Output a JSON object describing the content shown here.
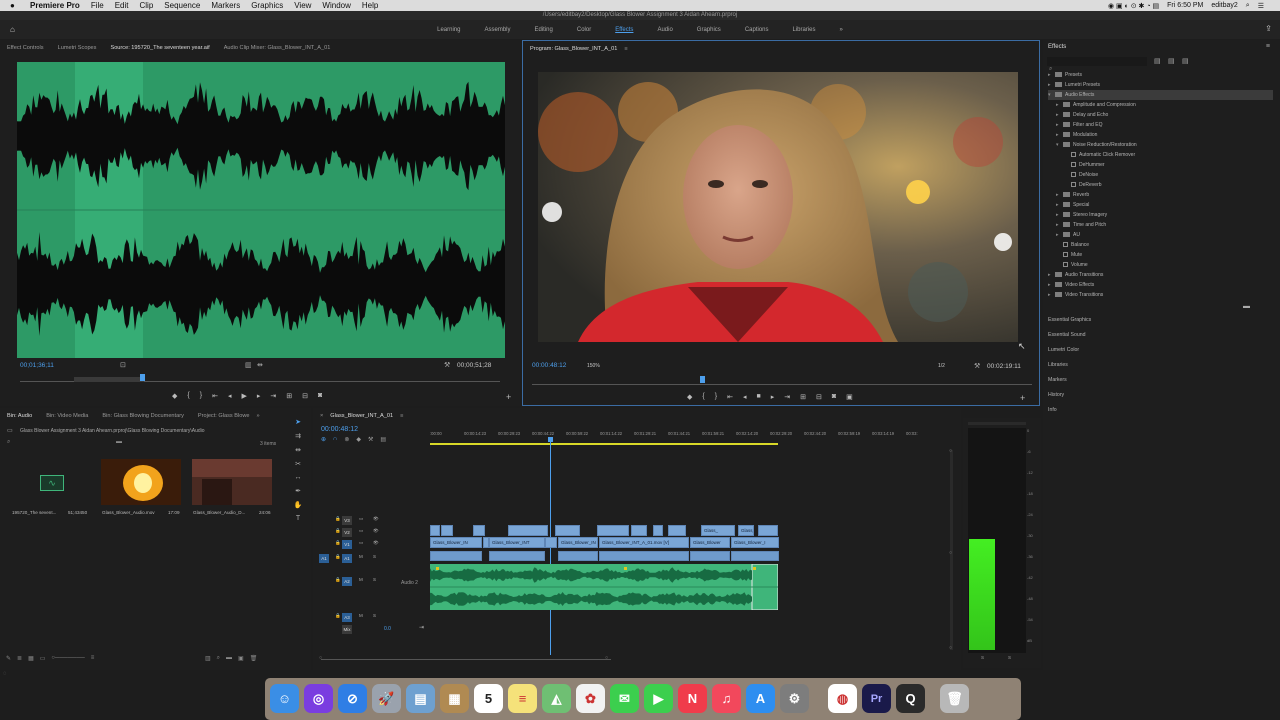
{
  "menubar": {
    "apple": "",
    "app_name": "Premiere Pro",
    "items": [
      "File",
      "Edit",
      "Clip",
      "Sequence",
      "Markers",
      "Graphics",
      "View",
      "Window",
      "Help"
    ],
    "clock": "Fri 6:50 PM",
    "user": "editbay2"
  },
  "titlebar": {
    "path": "/Users/editbay2/Desktop/Glass Blower Assignment 3 Aidan Ahearn.prproj"
  },
  "workspaces": [
    "Learning",
    "Assembly",
    "Editing",
    "Color",
    "Effects",
    "Audio",
    "Graphics",
    "Captions",
    "Libraries"
  ],
  "active_workspace": "Effects",
  "source_panel": {
    "tabs": [
      "Effect Controls",
      "Lumetri Scopes",
      "Source: 195720_The seventeen year.aif",
      "Audio Clip Mixer: Glass_Blower_INT_A_01"
    ],
    "timecode": "00;01;36;11",
    "duration": "00;00;51;28"
  },
  "program_panel": {
    "tab": "Program: Glass_Blower_INT_A_01",
    "timecode": "00:00:48:12",
    "zoom": "150%",
    "resolution": "1/2",
    "duration": "00:02:19:11"
  },
  "effects_panel": {
    "title": "Effects",
    "tree": [
      {
        "label": "Presets",
        "level": 0,
        "kind": "folder",
        "arrow": "▸"
      },
      {
        "label": "Lumetri Presets",
        "level": 0,
        "kind": "folder",
        "arrow": "▸"
      },
      {
        "label": "Audio Effects",
        "level": 0,
        "kind": "folder",
        "arrow": "▾",
        "selected": true
      },
      {
        "label": "Amplitude and Compression",
        "level": 1,
        "kind": "folder",
        "arrow": "▸"
      },
      {
        "label": "Delay and Echo",
        "level": 1,
        "kind": "folder",
        "arrow": "▸"
      },
      {
        "label": "Filter and EQ",
        "level": 1,
        "kind": "folder",
        "arrow": "▸"
      },
      {
        "label": "Modulation",
        "level": 1,
        "kind": "folder",
        "arrow": "▸"
      },
      {
        "label": "Noise Reduction/Restoration",
        "level": 1,
        "kind": "folder",
        "arrow": "▾"
      },
      {
        "label": "Automatic Click Remover",
        "level": 2,
        "kind": "fx",
        "arrow": ""
      },
      {
        "label": "DeHummer",
        "level": 2,
        "kind": "fx",
        "arrow": ""
      },
      {
        "label": "DeNoise",
        "level": 2,
        "kind": "fx",
        "arrow": ""
      },
      {
        "label": "DeReverb",
        "level": 2,
        "kind": "fx",
        "arrow": ""
      },
      {
        "label": "Reverb",
        "level": 1,
        "kind": "folder",
        "arrow": "▸"
      },
      {
        "label": "Special",
        "level": 1,
        "kind": "folder",
        "arrow": "▸"
      },
      {
        "label": "Stereo Imagery",
        "level": 1,
        "kind": "folder",
        "arrow": "▸"
      },
      {
        "label": "Time and Pitch",
        "level": 1,
        "kind": "folder",
        "arrow": "▸"
      },
      {
        "label": "AU",
        "level": 1,
        "kind": "folder",
        "arrow": "▸"
      },
      {
        "label": "Balance",
        "level": 1,
        "kind": "fx",
        "arrow": ""
      },
      {
        "label": "Mute",
        "level": 1,
        "kind": "fx",
        "arrow": ""
      },
      {
        "label": "Volume",
        "level": 1,
        "kind": "fx",
        "arrow": ""
      },
      {
        "label": "Audio Transitions",
        "level": 0,
        "kind": "folder",
        "arrow": "▸"
      },
      {
        "label": "Video Effects",
        "level": 0,
        "kind": "folder",
        "arrow": "▸"
      },
      {
        "label": "Video Transitions",
        "level": 0,
        "kind": "folder",
        "arrow": "▸"
      }
    ],
    "collapsed_panels": [
      "Essential Graphics",
      "Essential Sound",
      "Lumetri Color",
      "Libraries",
      "Markers",
      "History",
      "Info"
    ]
  },
  "project_panel": {
    "tabs": [
      "Bin: Audio",
      "Bin: Video Media",
      "Bin: Glass Blowing Documentary",
      "Project: Glass Blowe"
    ],
    "path": "Glass Blower Assignment 3 Aidan Ahearn.prproj\\Glass Blowing Documentary\\Audio",
    "count": "3 items",
    "items": [
      {
        "name": "195720_The sevent...",
        "duration": "51;43450"
      },
      {
        "name": "Glass_Blower_Audio.mov",
        "duration": "17:09"
      },
      {
        "name": "Glass_Blower_Audio_D...",
        "duration": "24:06"
      }
    ]
  },
  "timeline_panel": {
    "tab": "Glass_Blower_INT_A_01",
    "timecode": "00:00:48:12",
    "ruler": [
      ":00:00",
      "00:00:14:23",
      "00:00:29:23",
      "00:00:44:22",
      "00:00:59:22",
      "00:01:14:22",
      "00:01:29:21",
      "00:01:44:21",
      "00:01:59:21",
      "00:02:14:20",
      "00:02:29:20",
      "00:02:44:20",
      "00:02:59:19",
      "00:03:14:19",
      "00:03:"
    ],
    "tracks": [
      "V3",
      "V2",
      "V1",
      "A1",
      "A2",
      "A3",
      "Mix"
    ],
    "audio2_label": "Audio 2",
    "mix_value": "0.0",
    "clip_labels": [
      "Glass_Blower_IN",
      "Glass_Blower_INT",
      "Glass_Blower_IN",
      "Glass_Blower_INT_A_01.mov [V]",
      "Glass_Blower",
      "Glass_Blower_I",
      "Glass_",
      "Glass_Blower"
    ]
  },
  "audio_meter": {
    "scale": [
      "0",
      "-6",
      "-12",
      "-18",
      "-24",
      "-30",
      "-36",
      "-42",
      "-48",
      "-54",
      "dB"
    ],
    "channel_labels": [
      "S",
      "S"
    ],
    "level": 0.58
  },
  "dock": {
    "calendar_day": "5",
    "apps": [
      "Finder",
      "Siri",
      "Safari",
      "Launchpad",
      "Preview",
      "Archive",
      "Calendar",
      "Notes",
      "Maps",
      "Photos",
      "Messages",
      "FaceTime",
      "News",
      "Music",
      "App Store",
      "System Preferences",
      "Chrome",
      "Premiere Pro",
      "QuickTime",
      "Trash"
    ]
  },
  "colors": {
    "accent": "#4d9fec",
    "waveform_bg": "#2d9a66",
    "audio_clip": "#3fb57a",
    "video_clip": "#7aa6d6",
    "meter": "#44ee22"
  }
}
